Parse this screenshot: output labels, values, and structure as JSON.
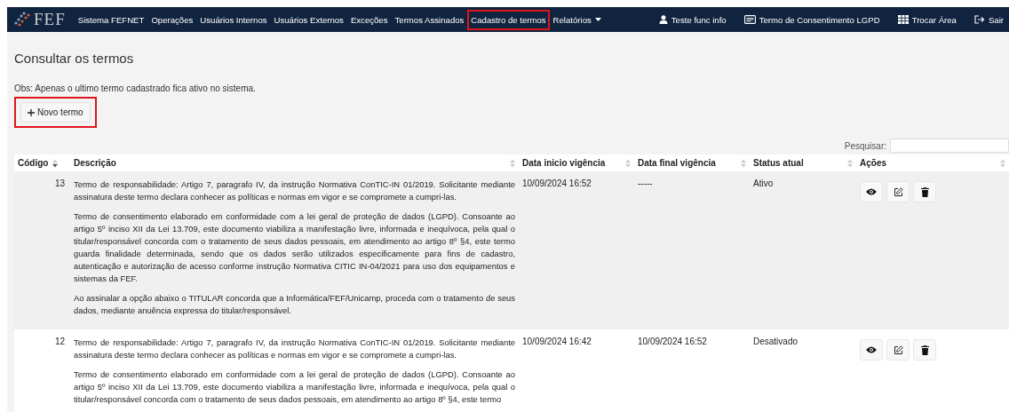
{
  "navbar": {
    "logo": "FEF",
    "items": [
      {
        "label": "Sistema FEFNET",
        "highlighted": false,
        "dropdown": false
      },
      {
        "label": "Operações",
        "highlighted": false,
        "dropdown": false
      },
      {
        "label": "Usuários Internos",
        "highlighted": false,
        "dropdown": false
      },
      {
        "label": "Usuários Externos",
        "highlighted": false,
        "dropdown": false
      },
      {
        "label": "Exceções",
        "highlighted": false,
        "dropdown": false
      },
      {
        "label": "Termos Assinados",
        "highlighted": false,
        "dropdown": false
      },
      {
        "label": "Cadastro de termos",
        "highlighted": true,
        "dropdown": false
      },
      {
        "label": "Relatórios",
        "highlighted": false,
        "dropdown": true
      }
    ],
    "right_items": [
      {
        "kind": "user",
        "label": "Teste func info"
      },
      {
        "kind": "card",
        "label": "Termo de Consentimento LGPD"
      },
      {
        "kind": "grid",
        "label": "Trocar Área"
      },
      {
        "kind": "exit",
        "label": "Sair"
      }
    ]
  },
  "page": {
    "title": "Consultar os termos",
    "note": "Obs: Apenas o ultimo termo cadastrado fica ativo no sistema.",
    "new_button": {
      "label": "Novo termo",
      "highlighted": true
    },
    "search": {
      "label": "Pesquisar:"
    }
  },
  "table": {
    "columns": [
      {
        "label": "Código",
        "sorted": true
      },
      {
        "label": "Descrição",
        "sorted": false
      },
      {
        "label": "Data inicio vigência",
        "sorted": false
      },
      {
        "label": "Data final vigência",
        "sorted": false
      },
      {
        "label": "Status atual",
        "sorted": false
      },
      {
        "label": "Ações",
        "sorted": false
      }
    ],
    "rows": [
      {
        "code": "13",
        "description": [
          "Termo de responsabilidade: Artigo 7, paragrafo IV, da instrução Normativa ConTIC-IN 01/2019. Solicitante mediante assinatura deste termo declara conhecer as políticas e normas em vigor e se compromete a cumpri-las.",
          "Termo de consentimento elaborado em conformidade com a lei geral de proteção de dados (LGPD). Consoante ao artigo 5º inciso XII da Lei 13.709, este documento viabiliza a manifestação livre, informada e inequívoca, pela qual o titular/responsável concorda com o tratamento de seus dados pessoais, em atendimento ao artigo 8º §4, este termo guarda finalidade determinada, sendo que os dados serão utilizados especificamente para fins de cadastro, autenticação e autorização de acesso conforme instrução Normativa CITIC IN-04/2021 para uso dos equipamentos e sistemas da FEF.",
          "Ao assinalar a opção abaixo o TITULAR concorda que a Informática/FEF/Unicamp, proceda com o tratamento de seus dados, mediante anuência expressa do titular/responsável."
        ],
        "start": "10/09/2024 16:52",
        "end": "-----",
        "status": "Ativo"
      },
      {
        "code": "12",
        "description": [
          "Termo de responsabilidade: Artigo 7, paragrafo IV, da instrução Normativa ConTIC-IN 01/2019. Solicitante mediante assinatura deste termo declara conhecer as políticas e normas em vigor e se compromete a cumpri-las.",
          "Termo de consentimento elaborado em conformidade com a lei geral de proteção de dados (LGPD). Consoante ao artigo 5º inciso XII da Lei 13.709, este documento viabiliza a manifestação livre, informada e inequívoca, pela qual o titular/responsável concorda com o tratamento de seus dados pessoais, em atendimento ao artigo 8º §4, este termo"
        ],
        "start": "10/09/2024 16:42",
        "end": "10/09/2024 16:52",
        "status": "Desativado"
      }
    ]
  }
}
